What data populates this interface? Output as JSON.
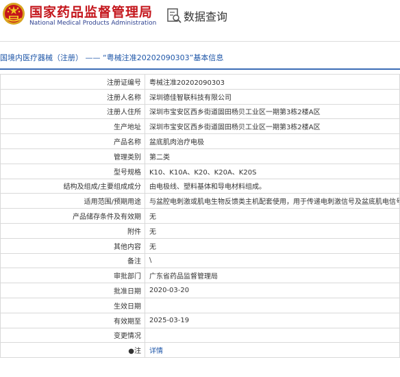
{
  "header": {
    "org_name_cn": "国家药品监督管理局",
    "org_name_en": "National Medical Products Administration",
    "search_title": "数据查询"
  },
  "breadcrumb": {
    "prefix": "国境内医疗器械（注册）",
    "dash": "——",
    "title": "“粤械注准20202090303”基本信息"
  },
  "rows": [
    {
      "label": "注册证编号",
      "value": "粤械注准20202090303"
    },
    {
      "label": "注册人名称",
      "value": "深圳德佳智联科技有限公司"
    },
    {
      "label": "注册人住所",
      "value": "深圳市宝安区西乡街道固田杨贝工业区一期第3栋2楼A区"
    },
    {
      "label": "生产地址",
      "value": "深圳市宝安区西乡街道固田杨贝工业区一期第3栋2楼A区"
    },
    {
      "label": "产品名称",
      "value": "盆底肌肉治疗电极"
    },
    {
      "label": "管理类别",
      "value": "第二类"
    },
    {
      "label": "型号规格",
      "value": "K10、K10A、K20、K20A、K20S"
    },
    {
      "label": "结构及组成/主要组成成分",
      "value": "由电极线、塑料基体和导电材料组成。"
    },
    {
      "label": "适用范围/预期用途",
      "value": "与盆腔电刺激或肌电生物反馈类主机配套使用，用于传递电刺激信号及盆底肌电信号。"
    },
    {
      "label": "产品储存条件及有效期",
      "value": "无"
    },
    {
      "label": "附件",
      "value": "无"
    },
    {
      "label": "其他内容",
      "value": "无"
    },
    {
      "label": "备注",
      "value": "\\"
    },
    {
      "label": "审批部门",
      "value": "广东省药品监督管理局"
    },
    {
      "label": "批准日期",
      "value": "2020-03-20"
    },
    {
      "label": "生效日期",
      "value": ""
    },
    {
      "label": "有效期至",
      "value": "2025-03-19"
    },
    {
      "label": "变更情况",
      "value": ""
    },
    {
      "label": "●注",
      "value": "详情"
    }
  ]
}
